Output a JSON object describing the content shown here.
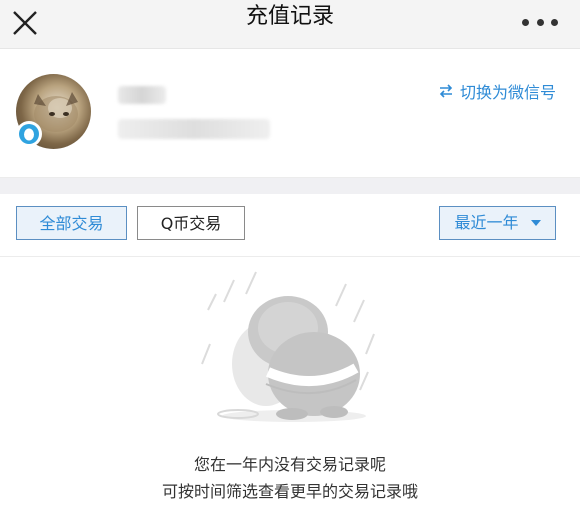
{
  "header": {
    "title": "充值记录",
    "close_icon": "close-icon",
    "more_icon": "more-dots-icon"
  },
  "profile": {
    "switch_label": "切换为微信号",
    "switch_icon": "swap-arrows-icon",
    "badge_icon": "qq-penguin-icon"
  },
  "filters": {
    "all_label": "全部交易",
    "qb_label": "Q币交易",
    "range_label": "最近一年"
  },
  "empty_state": {
    "line1": "您在一年内没有交易记录呢",
    "line2": "可按时间筛选查看更早的交易记录哦"
  },
  "colors": {
    "accent": "#2f8bd6",
    "chip_fill": "#eaf2fa"
  }
}
